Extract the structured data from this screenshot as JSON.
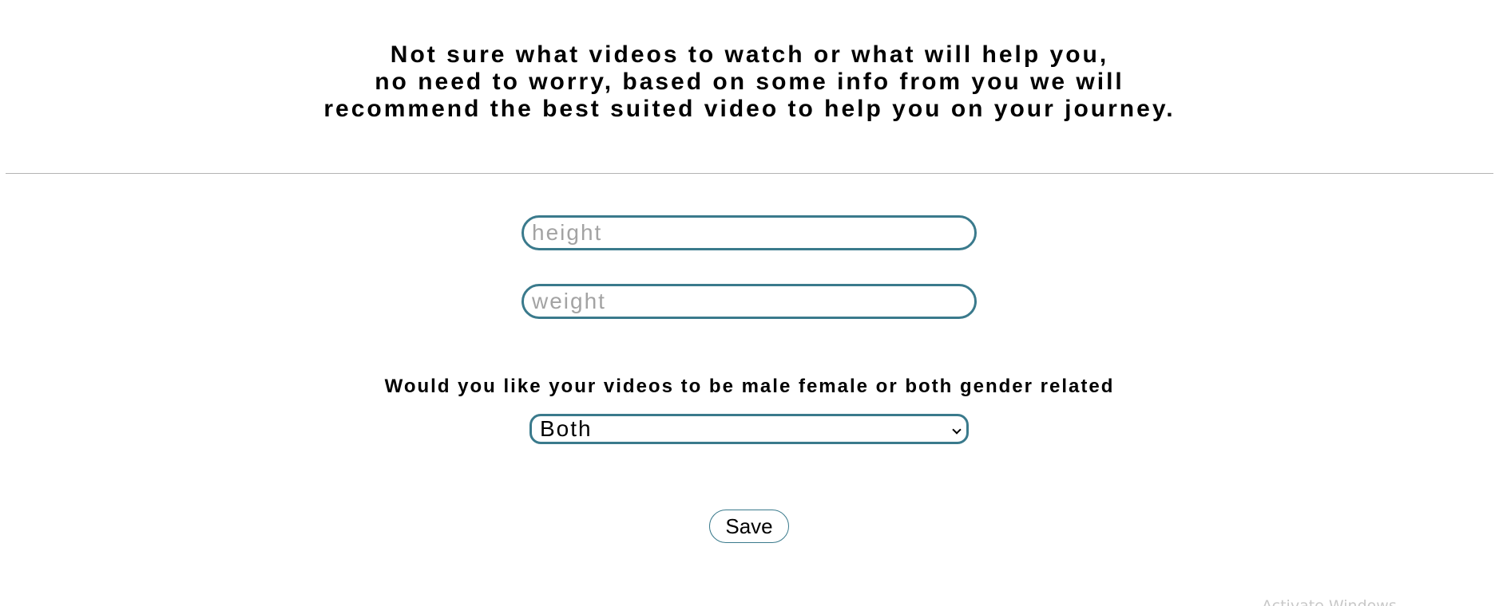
{
  "intro": {
    "line1": "Not sure what videos to watch or what will help you,",
    "line2": "no need to worry, based on some info from you we will",
    "line3": "recommend the best suited video to help you on your journey."
  },
  "form": {
    "height": {
      "value": "",
      "placeholder": "height"
    },
    "weight": {
      "value": "",
      "placeholder": "weight"
    },
    "gender_question": "Would you like your videos to be male female or both gender related",
    "gender_select": {
      "selected": "Both"
    },
    "save_label": "Save"
  },
  "os_watermark": "Activate Windows",
  "colors": {
    "accent_border": "#3a7a8c",
    "placeholder_text": "#a3a3a3",
    "divider": "#b4b4b4"
  },
  "icons": {
    "select_arrow": "chevron-down-icon"
  }
}
